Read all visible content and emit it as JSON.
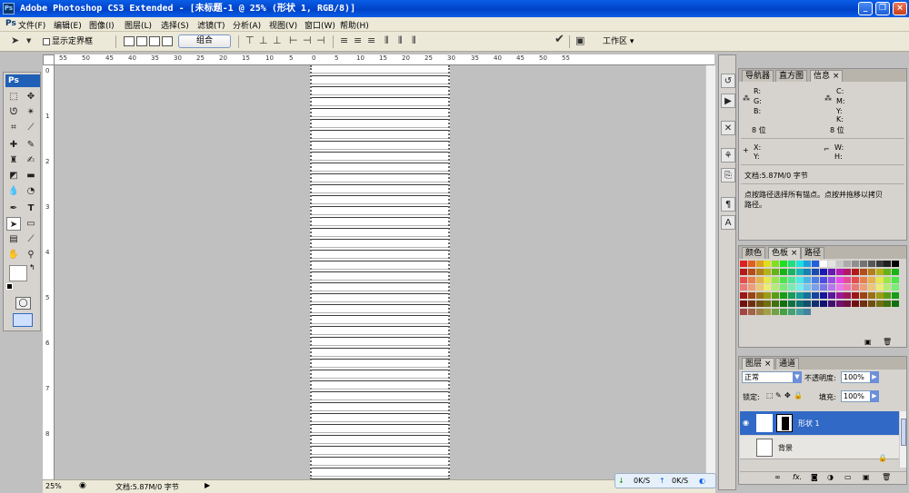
{
  "window": {
    "title": "Adobe Photoshop CS3 Extended - [未标题-1 @ 25% (形状 1, RGB/8)]",
    "app_icon": "Ps",
    "min": "_",
    "restore": "❐",
    "close": "×"
  },
  "menu": {
    "items": [
      "文件(F)",
      "编辑(E)",
      "图像(I)",
      "图层(L)",
      "选择(S)",
      "滤镜(T)",
      "分析(A)",
      "视图(V)",
      "窗口(W)",
      "帮助(H)"
    ]
  },
  "options": {
    "show_bounds": "显示定界框",
    "combine": "组合",
    "workspace": "工作区 ▾"
  },
  "toolbox": {
    "logo": "Ps"
  },
  "rulers": {
    "top": [
      "55",
      "50",
      "45",
      "40",
      "35",
      "30",
      "25",
      "20",
      "15",
      "10",
      "5",
      "0",
      "5",
      "10",
      "15",
      "20",
      "25",
      "30",
      "35",
      "40",
      "45",
      "50",
      "55"
    ],
    "left": [
      "0",
      "1",
      "2",
      "3",
      "4",
      "5",
      "6",
      "7",
      "8"
    ]
  },
  "status": {
    "zoom": "25%",
    "doc": "文档:5.87M/0 字节"
  },
  "info_panel": {
    "tabs": [
      "导航器",
      "直方图",
      "信息 ×"
    ],
    "r": "R:",
    "g": "G:",
    "b": "B:",
    "c": "C:",
    "m": "M:",
    "y": "Y:",
    "k": "K:",
    "bit_left": "8 位",
    "bit_right": "8 位",
    "x": "X:",
    "ylab": "Y:",
    "w": "W:",
    "h": "H:",
    "doc": "文档:5.87M/0 字节",
    "hint": "点按路径选择所有锚点。点按并拖移以拷贝",
    "hint2": "路径。"
  },
  "swatch_panel": {
    "tabs": [
      "颜色",
      "色板 ×",
      "路径"
    ]
  },
  "layers_panel": {
    "tabs": [
      "图层 ×",
      "通道"
    ],
    "mode": "正常",
    "opacity_label": "不透明度:",
    "opacity": "100%",
    "lock_label": "锁定:",
    "fill_label": "填充:",
    "fill": "100%",
    "layer1": "形状 1",
    "layer2": "背景"
  },
  "taskbar": {
    "down": "0K/S",
    "up": "0K/S"
  },
  "colors": {
    "title": "#0a5ee6",
    "selection": "#3169c6",
    "canvas_line": "#b4b4b4"
  }
}
